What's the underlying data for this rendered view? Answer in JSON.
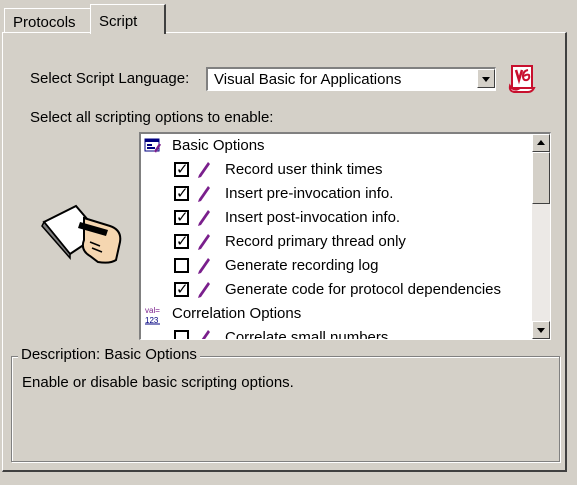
{
  "tabs": [
    {
      "label": "Protocols"
    },
    {
      "label": "Script"
    }
  ],
  "script_language": {
    "label": "Select Script Language:",
    "value": "Visual Basic for Applications"
  },
  "options_label": "Select all scripting options to enable:",
  "options_list": {
    "group_basic": "Basic Options",
    "items": [
      {
        "label": "Record user think times",
        "checked": true
      },
      {
        "label": "Insert pre-invocation info.",
        "checked": true
      },
      {
        "label": "Insert post-invocation info.",
        "checked": true
      },
      {
        "label": "Record primary thread only",
        "checked": true
      },
      {
        "label": "Generate recording log",
        "checked": false
      },
      {
        "label": "Generate code for protocol dependencies",
        "checked": true
      }
    ],
    "group_correlation": "Correlation Options",
    "correlation_items": [
      {
        "label": "Correlate small numbers",
        "checked": false
      }
    ],
    "group_correlation_icon_text": "val=\n123"
  },
  "description": {
    "title": "Description: Basic Options",
    "text": "Enable or disable basic scripting options."
  },
  "colors": {
    "face": "#d4d0c8",
    "pen": "#7a1f8c",
    "vba_icon": "#c8102e"
  }
}
